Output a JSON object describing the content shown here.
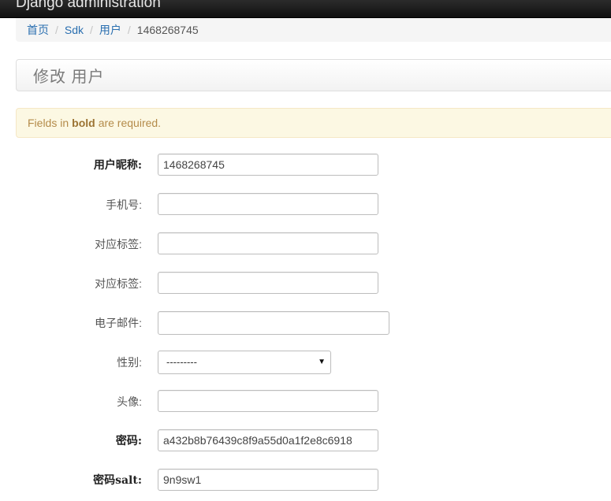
{
  "header": {
    "brand": "Django administration"
  },
  "breadcrumbs": {
    "home": "首页",
    "app": "Sdk",
    "model": "用户",
    "current": "1468268745",
    "separator": "/"
  },
  "page": {
    "title": "修改 用户"
  },
  "notice": {
    "prefix": "Fields in",
    "bold": "bold",
    "suffix": "are required."
  },
  "form": {
    "nickname": {
      "label": "用户昵称:",
      "value": "1468268745"
    },
    "phone": {
      "label": "手机号:",
      "value": ""
    },
    "tag1": {
      "label": "对应标签:",
      "value": ""
    },
    "tag2": {
      "label": "对应标签:",
      "value": ""
    },
    "email": {
      "label": "电子邮件:",
      "value": ""
    },
    "gender": {
      "label": "性别:",
      "selected": "---------",
      "caret": "▼"
    },
    "avatar": {
      "label": "头像:",
      "value": ""
    },
    "password": {
      "label": "密码:",
      "value": "a432b8b76439c8f9a55d0a1f2e8c6918"
    },
    "salt": {
      "label": "密码salt:",
      "value": "9n9sw1"
    }
  },
  "colors": {
    "link": "#2a6fb0",
    "notice_bg": "#fcf8e3",
    "topbar": "#1a1a1a"
  }
}
